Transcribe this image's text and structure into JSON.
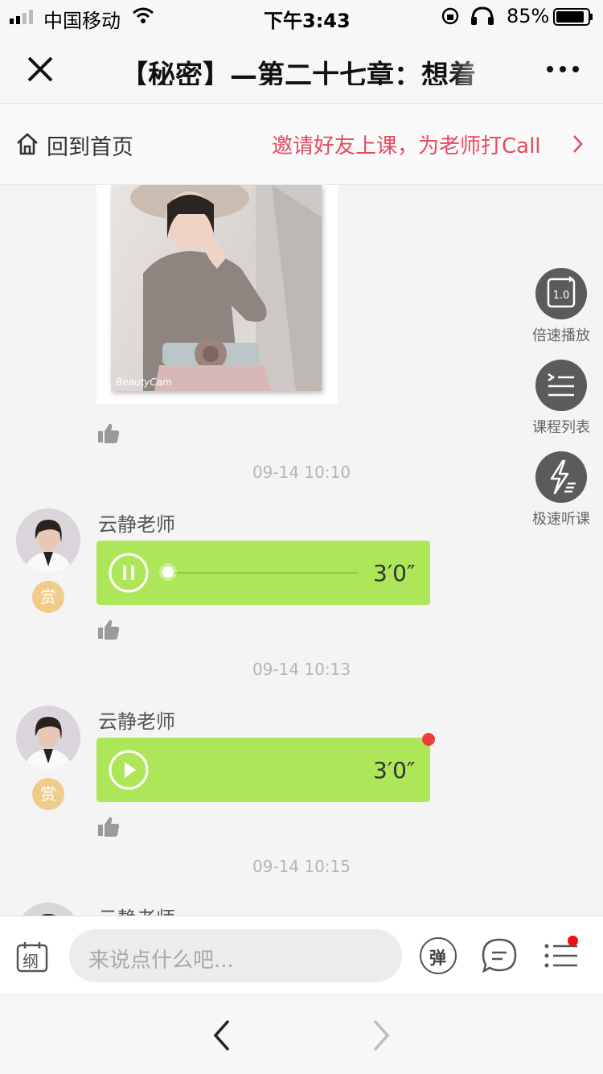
{
  "status_bar": {
    "carrier": "中国移动",
    "time": "下午3:43",
    "battery": "85%"
  },
  "navbar": {
    "title": "【秘密】—第二十七章：想着"
  },
  "subbar": {
    "home_label": "回到首页",
    "invite_text": "邀请好友上课，为老师打Call"
  },
  "side_buttons": [
    {
      "label": "倍速播放",
      "icon_text": "1.0"
    },
    {
      "label": "课程列表"
    },
    {
      "label": "极速听课"
    }
  ],
  "chat": {
    "photo_watermark": "BeautyCam",
    "timestamps": [
      "09-14 10:10",
      "09-14 10:13",
      "09-14 10:15"
    ],
    "messages": [
      {
        "sender": "云静老师",
        "reward": "赏",
        "duration": "3′0″",
        "state": "playing"
      },
      {
        "sender": "云静老师",
        "reward": "赏",
        "duration": "3′0″",
        "state": "paused"
      }
    ],
    "partial_sender": "云静老师"
  },
  "input_bar": {
    "outline_icon_text": "纲",
    "placeholder": "来说点什么吧...",
    "barrage_label": "弹"
  },
  "colors": {
    "accent_red": "#e64a5f",
    "bubble_green": "#aee65a",
    "side_button_gray": "#5b5b5b",
    "reward_gold": "#f0cc8a"
  }
}
